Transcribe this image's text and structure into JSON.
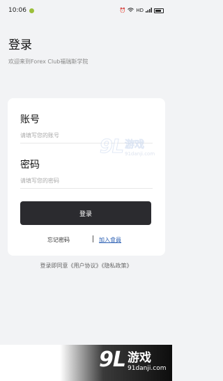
{
  "status_bar": {
    "time": "10:06",
    "right_text": "HD"
  },
  "header": {
    "title": "登录",
    "subtitle": "欢迎来到Forex Club福瑞斯学院"
  },
  "form": {
    "account_label": "账号",
    "account_placeholder": "请填写您的账号",
    "password_label": "密码",
    "password_placeholder": "请填写您的密码",
    "login_button": "登录",
    "forgot_password": "忘记密码",
    "divider": "|",
    "join_member": "加入會員"
  },
  "agreement": "登录即同意《用户协议》《隐私政策》",
  "watermark": {
    "logo": "9L",
    "title": "游戏",
    "url": "91danji.com"
  },
  "colors": {
    "background": "#f2f3f5",
    "button": "#2b2b2f",
    "link": "#2b5fb3"
  }
}
